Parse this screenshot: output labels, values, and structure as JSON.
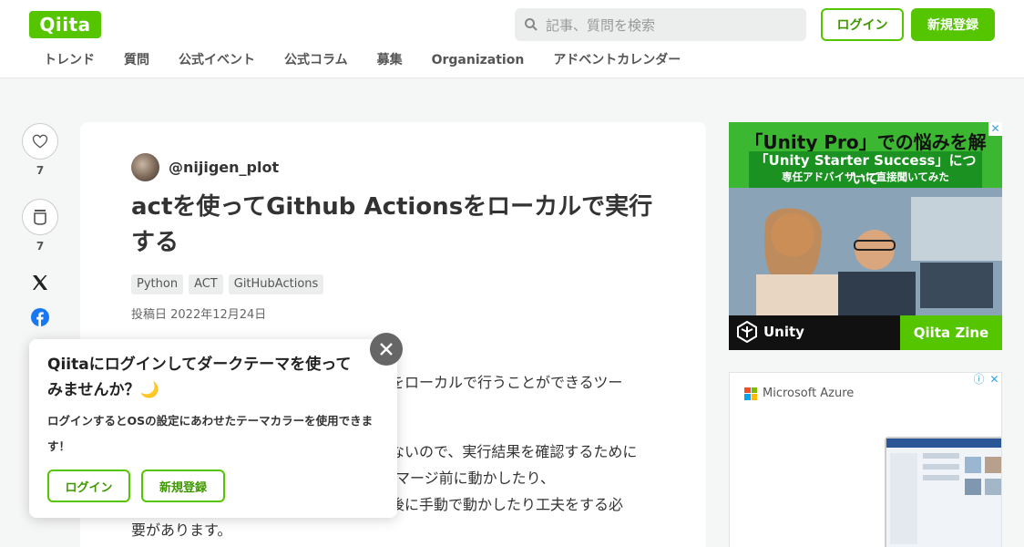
{
  "header": {
    "logo": "Qiita",
    "search_placeholder": "記事、質問を検索",
    "login_label": "ログイン",
    "signup_label": "新規登録",
    "nav": [
      "トレンド",
      "質問",
      "公式イベント",
      "公式コラム",
      "募集",
      "Organization",
      "アドベントカレンダー"
    ]
  },
  "actions": {
    "like_count": "7",
    "stock_count": "7",
    "icons": [
      "heart-icon",
      "stock-icon",
      "x-icon",
      "facebook-icon",
      "hatena-icon",
      "more-icon"
    ]
  },
  "article": {
    "author": "@nijigen_plot",
    "title": "actを使ってGithub Actionsをローカルで実行する",
    "tags": [
      "Python",
      "ACT",
      "GitHubActions"
    ],
    "posted": "投稿日 2022年12月24日",
    "body_lines": [
      "をローカルで行うことができるツー",
      "ないので、実行結果を確認するために",
      "マージ前に動かしたり、",
      "後に手動で動かしたり工夫をする必",
      "要があります。"
    ]
  },
  "popup": {
    "title": "Qiitaにログインしてダークテーマを使ってみませんか？🌙",
    "desc": "ログインするとOSの設定にあわせたテーマカラーを使用できます！",
    "login_label": "ログイン",
    "signup_label": "新規登録"
  },
  "ads": {
    "unity": {
      "headline": "「Unity Pro」での悩みを解決！",
      "sub": "「Unity Starter Success」について",
      "sub2": "専任アドバイザーに直接聞いてみた",
      "brand": "Unity",
      "zine": "Qiita Zine"
    },
    "azure": {
      "brand": "Microsoft Azure"
    }
  },
  "colors": {
    "brand": "#55c500",
    "background": "#f5f6f6"
  }
}
